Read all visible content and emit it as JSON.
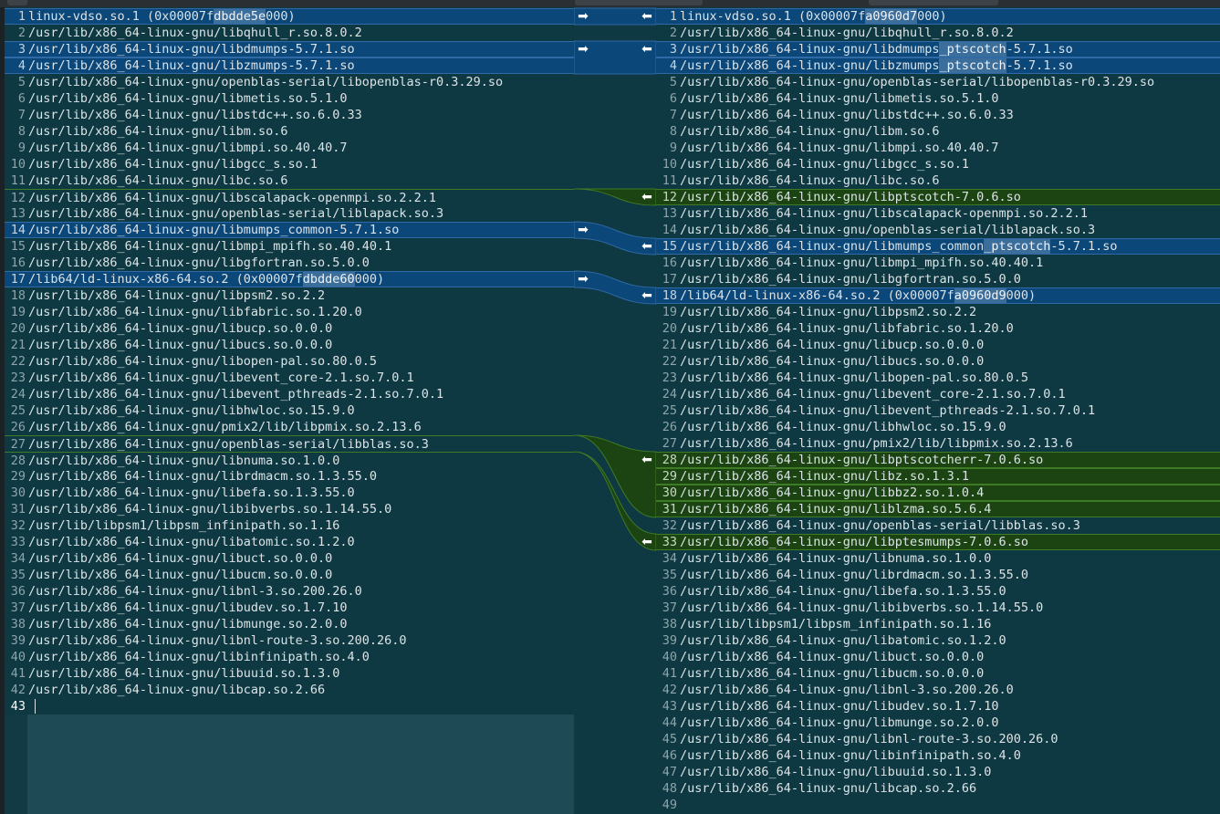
{
  "left": {
    "lines": [
      {
        "n": "1",
        "text": "linux-vdso.so.1 (0x00007fdbdde5e000)",
        "hl": "dbdde5e",
        "state": "changed"
      },
      {
        "n": "2",
        "text": "/usr/lib/x86_64-linux-gnu/libqhull_r.so.8.0.2"
      },
      {
        "n": "3",
        "text": "/usr/lib/x86_64-linux-gnu/libdmumps-5.7.1.so",
        "state": "changed"
      },
      {
        "n": "4",
        "text": "/usr/lib/x86_64-linux-gnu/libzmumps-5.7.1.so",
        "state": "changed"
      },
      {
        "n": "5",
        "text": "/usr/lib/x86_64-linux-gnu/openblas-serial/libopenblas-r0.3.29.so"
      },
      {
        "n": "6",
        "text": "/usr/lib/x86_64-linux-gnu/libmetis.so.5.1.0"
      },
      {
        "n": "7",
        "text": "/usr/lib/x86_64-linux-gnu/libstdc++.so.6.0.33"
      },
      {
        "n": "8",
        "text": "/usr/lib/x86_64-linux-gnu/libm.so.6"
      },
      {
        "n": "9",
        "text": "/usr/lib/x86_64-linux-gnu/libmpi.so.40.40.7"
      },
      {
        "n": "10",
        "text": "/usr/lib/x86_64-linux-gnu/libgcc_s.so.1"
      },
      {
        "n": "11",
        "text": "/usr/lib/x86_64-linux-gnu/libc.so.6"
      },
      {
        "n": "12",
        "text": "/usr/lib/x86_64-linux-gnu/libscalapack-openmpi.so.2.2.1",
        "state": "marked"
      },
      {
        "n": "13",
        "text": "/usr/lib/x86_64-linux-gnu/openblas-serial/liblapack.so.3"
      },
      {
        "n": "14",
        "text": "/usr/lib/x86_64-linux-gnu/libmumps_common-5.7.1.so",
        "state": "changed"
      },
      {
        "n": "15",
        "text": "/usr/lib/x86_64-linux-gnu/libmpi_mpifh.so.40.40.1"
      },
      {
        "n": "16",
        "text": "/usr/lib/x86_64-linux-gnu/libgfortran.so.5.0.0"
      },
      {
        "n": "17",
        "text": "/lib64/ld-linux-x86-64.so.2 (0x00007fdbdde60000)",
        "hl": "dbdde60",
        "state": "changed"
      },
      {
        "n": "18",
        "text": "/usr/lib/x86_64-linux-gnu/libpsm2.so.2.2"
      },
      {
        "n": "19",
        "text": "/usr/lib/x86_64-linux-gnu/libfabric.so.1.20.0"
      },
      {
        "n": "20",
        "text": "/usr/lib/x86_64-linux-gnu/libucp.so.0.0.0"
      },
      {
        "n": "21",
        "text": "/usr/lib/x86_64-linux-gnu/libucs.so.0.0.0"
      },
      {
        "n": "22",
        "text": "/usr/lib/x86_64-linux-gnu/libopen-pal.so.80.0.5"
      },
      {
        "n": "23",
        "text": "/usr/lib/x86_64-linux-gnu/libevent_core-2.1.so.7.0.1"
      },
      {
        "n": "24",
        "text": "/usr/lib/x86_64-linux-gnu/libevent_pthreads-2.1.so.7.0.1"
      },
      {
        "n": "25",
        "text": "/usr/lib/x86_64-linux-gnu/libhwloc.so.15.9.0"
      },
      {
        "n": "26",
        "text": "/usr/lib/x86_64-linux-gnu/pmix2/lib/libpmix.so.2.13.6"
      },
      {
        "n": "27",
        "text": "/usr/lib/x86_64-linux-gnu/openblas-serial/libblas.so.3",
        "state": "marked"
      },
      {
        "n": "28",
        "text": "/usr/lib/x86_64-linux-gnu/libnuma.so.1.0.0",
        "state": "marked"
      },
      {
        "n": "29",
        "text": "/usr/lib/x86_64-linux-gnu/librdmacm.so.1.3.55.0"
      },
      {
        "n": "30",
        "text": "/usr/lib/x86_64-linux-gnu/libefa.so.1.3.55.0"
      },
      {
        "n": "31",
        "text": "/usr/lib/x86_64-linux-gnu/libibverbs.so.1.14.55.0"
      },
      {
        "n": "32",
        "text": "/usr/lib/libpsm1/libpsm_infinipath.so.1.16"
      },
      {
        "n": "33",
        "text": "/usr/lib/x86_64-linux-gnu/libatomic.so.1.2.0"
      },
      {
        "n": "34",
        "text": "/usr/lib/x86_64-linux-gnu/libuct.so.0.0.0"
      },
      {
        "n": "35",
        "text": "/usr/lib/x86_64-linux-gnu/libucm.so.0.0.0"
      },
      {
        "n": "36",
        "text": "/usr/lib/x86_64-linux-gnu/libnl-3.so.200.26.0"
      },
      {
        "n": "37",
        "text": "/usr/lib/x86_64-linux-gnu/libudev.so.1.7.10"
      },
      {
        "n": "38",
        "text": "/usr/lib/x86_64-linux-gnu/libmunge.so.2.0.0"
      },
      {
        "n": "39",
        "text": "/usr/lib/x86_64-linux-gnu/libnl-route-3.so.200.26.0"
      },
      {
        "n": "40",
        "text": "/usr/lib/x86_64-linux-gnu/libinfinipath.so.4.0"
      },
      {
        "n": "41",
        "text": "/usr/lib/x86_64-linux-gnu/libuuid.so.1.3.0"
      },
      {
        "n": "42",
        "text": "/usr/lib/x86_64-linux-gnu/libcap.so.2.66"
      },
      {
        "n": "43",
        "text": "",
        "state": "current"
      }
    ]
  },
  "right": {
    "lines": [
      {
        "n": "1",
        "text": "linux-vdso.so.1 (0x00007fa0960d7000)",
        "hl": "a0960d7",
        "state": "changed"
      },
      {
        "n": "2",
        "text": "/usr/lib/x86_64-linux-gnu/libqhull_r.so.8.0.2"
      },
      {
        "n": "3",
        "text": "/usr/lib/x86_64-linux-gnu/libdmumps_ptscotch-5.7.1.so",
        "hl": "_ptscotch",
        "state": "changed"
      },
      {
        "n": "4",
        "text": "/usr/lib/x86_64-linux-gnu/libzmumps_ptscotch-5.7.1.so",
        "hl": "_ptscotch",
        "state": "changed"
      },
      {
        "n": "5",
        "text": "/usr/lib/x86_64-linux-gnu/openblas-serial/libopenblas-r0.3.29.so"
      },
      {
        "n": "6",
        "text": "/usr/lib/x86_64-linux-gnu/libmetis.so.5.1.0"
      },
      {
        "n": "7",
        "text": "/usr/lib/x86_64-linux-gnu/libstdc++.so.6.0.33"
      },
      {
        "n": "8",
        "text": "/usr/lib/x86_64-linux-gnu/libm.so.6"
      },
      {
        "n": "9",
        "text": "/usr/lib/x86_64-linux-gnu/libmpi.so.40.40.7"
      },
      {
        "n": "10",
        "text": "/usr/lib/x86_64-linux-gnu/libgcc_s.so.1"
      },
      {
        "n": "11",
        "text": "/usr/lib/x86_64-linux-gnu/libc.so.6"
      },
      {
        "n": "12",
        "text": "/usr/lib/x86_64-linux-gnu/libptscotch-7.0.6.so",
        "state": "inserted"
      },
      {
        "n": "13",
        "text": "/usr/lib/x86_64-linux-gnu/libscalapack-openmpi.so.2.2.1"
      },
      {
        "n": "14",
        "text": "/usr/lib/x86_64-linux-gnu/openblas-serial/liblapack.so.3"
      },
      {
        "n": "15",
        "text": "/usr/lib/x86_64-linux-gnu/libmumps_common_ptscotch-5.7.1.so",
        "hl": "_ptscotch",
        "state": "changed"
      },
      {
        "n": "16",
        "text": "/usr/lib/x86_64-linux-gnu/libmpi_mpifh.so.40.40.1"
      },
      {
        "n": "17",
        "text": "/usr/lib/x86_64-linux-gnu/libgfortran.so.5.0.0"
      },
      {
        "n": "18",
        "text": "/lib64/ld-linux-x86-64.so.2 (0x00007fa0960d9000)",
        "hl": "a0960d9",
        "state": "changed"
      },
      {
        "n": "19",
        "text": "/usr/lib/x86_64-linux-gnu/libpsm2.so.2.2"
      },
      {
        "n": "20",
        "text": "/usr/lib/x86_64-linux-gnu/libfabric.so.1.20.0"
      },
      {
        "n": "21",
        "text": "/usr/lib/x86_64-linux-gnu/libucp.so.0.0.0"
      },
      {
        "n": "22",
        "text": "/usr/lib/x86_64-linux-gnu/libucs.so.0.0.0"
      },
      {
        "n": "23",
        "text": "/usr/lib/x86_64-linux-gnu/libopen-pal.so.80.0.5"
      },
      {
        "n": "24",
        "text": "/usr/lib/x86_64-linux-gnu/libevent_core-2.1.so.7.0.1"
      },
      {
        "n": "25",
        "text": "/usr/lib/x86_64-linux-gnu/libevent_pthreads-2.1.so.7.0.1"
      },
      {
        "n": "26",
        "text": "/usr/lib/x86_64-linux-gnu/libhwloc.so.15.9.0"
      },
      {
        "n": "27",
        "text": "/usr/lib/x86_64-linux-gnu/pmix2/lib/libpmix.so.2.13.6"
      },
      {
        "n": "28",
        "text": "/usr/lib/x86_64-linux-gnu/libptscotcherr-7.0.6.so",
        "state": "inserted"
      },
      {
        "n": "29",
        "text": "/usr/lib/x86_64-linux-gnu/libz.so.1.3.1",
        "state": "inserted"
      },
      {
        "n": "30",
        "text": "/usr/lib/x86_64-linux-gnu/libbz2.so.1.0.4",
        "state": "inserted"
      },
      {
        "n": "31",
        "text": "/usr/lib/x86_64-linux-gnu/liblzma.so.5.6.4",
        "state": "inserted"
      },
      {
        "n": "32",
        "text": "/usr/lib/x86_64-linux-gnu/openblas-serial/libblas.so.3"
      },
      {
        "n": "33",
        "text": "/usr/lib/x86_64-linux-gnu/libptesmumps-7.0.6.so",
        "state": "inserted"
      },
      {
        "n": "34",
        "text": "/usr/lib/x86_64-linux-gnu/libnuma.so.1.0.0"
      },
      {
        "n": "35",
        "text": "/usr/lib/x86_64-linux-gnu/librdmacm.so.1.3.55.0"
      },
      {
        "n": "36",
        "text": "/usr/lib/x86_64-linux-gnu/libefa.so.1.3.55.0"
      },
      {
        "n": "37",
        "text": "/usr/lib/x86_64-linux-gnu/libibverbs.so.1.14.55.0"
      },
      {
        "n": "38",
        "text": "/usr/lib/libpsm1/libpsm_infinipath.so.1.16"
      },
      {
        "n": "39",
        "text": "/usr/lib/x86_64-linux-gnu/libatomic.so.1.2.0"
      },
      {
        "n": "40",
        "text": "/usr/lib/x86_64-linux-gnu/libuct.so.0.0.0"
      },
      {
        "n": "41",
        "text": "/usr/lib/x86_64-linux-gnu/libucm.so.0.0.0"
      },
      {
        "n": "42",
        "text": "/usr/lib/x86_64-linux-gnu/libnl-3.so.200.26.0"
      },
      {
        "n": "43",
        "text": "/usr/lib/x86_64-linux-gnu/libudev.so.1.7.10"
      },
      {
        "n": "44",
        "text": "/usr/lib/x86_64-linux-gnu/libmunge.so.2.0.0"
      },
      {
        "n": "45",
        "text": "/usr/lib/x86_64-linux-gnu/libnl-route-3.so.200.26.0"
      },
      {
        "n": "46",
        "text": "/usr/lib/x86_64-linux-gnu/libinfinipath.so.4.0"
      },
      {
        "n": "47",
        "text": "/usr/lib/x86_64-linux-gnu/libuuid.so.1.3.0"
      },
      {
        "n": "48",
        "text": "/usr/lib/x86_64-linux-gnu/libcap.so.2.66"
      },
      {
        "n": "49",
        "text": ""
      }
    ]
  },
  "arrows": {
    "push_right": "➡",
    "push_left": "⬅",
    "icons": [
      "arrow-right-icon",
      "arrow-left-icon"
    ]
  },
  "colors": {
    "background": "#0e3942",
    "changed": "#0c4779",
    "inserted": "#1c4413",
    "inline_highlight": "#3c6e9c"
  }
}
